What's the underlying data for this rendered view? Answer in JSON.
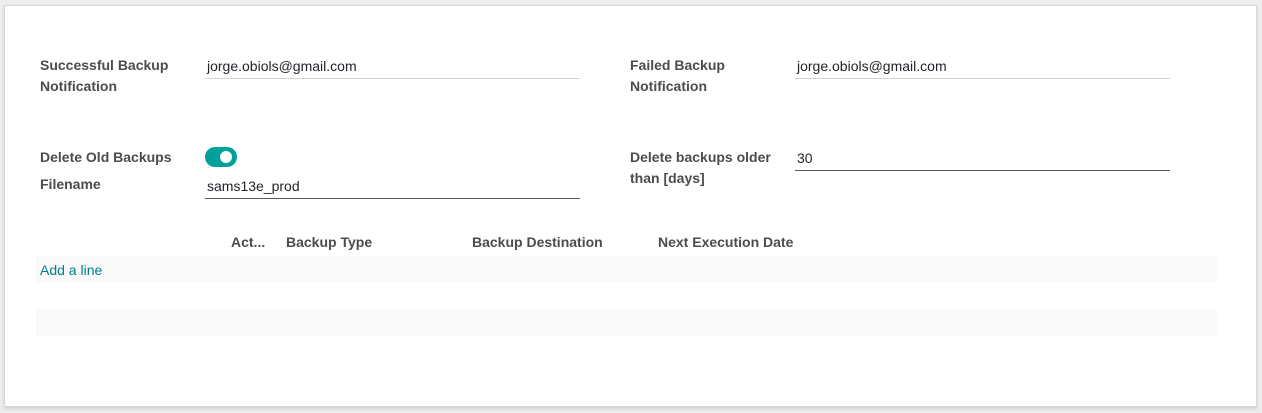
{
  "colors": {
    "accent": "#00A09D",
    "link": "#017e84",
    "label": "#4c4c4c"
  },
  "form": {
    "successful_backup_notification": {
      "label_line1": "Successful Backup",
      "label_line2": "Notification",
      "value": "jorge.obiols@gmail.com"
    },
    "failed_backup_notification": {
      "label_line1": "Failed Backup",
      "label_line2": "Notification",
      "value": "jorge.obiols@gmail.com"
    },
    "delete_old_backups": {
      "label": "Delete Old Backups",
      "enabled": true
    },
    "filename": {
      "label": "Filename",
      "value": "sams13e_prod"
    },
    "delete_backups_older": {
      "label_line1": "Delete backups older",
      "label_line2": "than [days]",
      "value": "30"
    }
  },
  "table": {
    "columns": [
      "Act...",
      "Backup Type",
      "Backup Destination",
      "Next Execution Date"
    ],
    "add_line_label": "Add a line"
  }
}
